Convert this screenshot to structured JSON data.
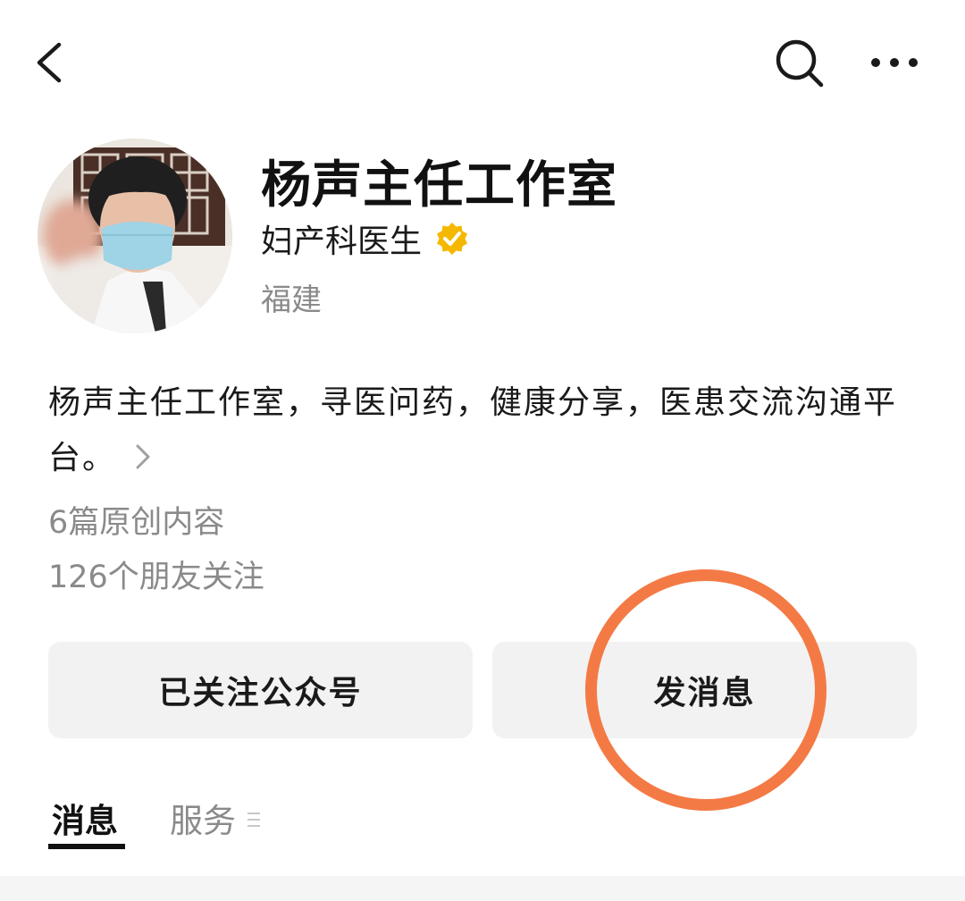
{
  "header": {
    "back_icon": "chevron-left-icon",
    "search_icon": "search-icon",
    "more_icon": "more-horizontal-icon"
  },
  "profile": {
    "name": "杨声主任工作室",
    "role": "妇产科医生",
    "verified_icon": "verified-badge-icon",
    "verified_color": "#f5b800",
    "region": "福建"
  },
  "description": {
    "text": "杨声主任工作室，寻医问药，健康分享，医患交流沟通平台。",
    "arrow_icon": "chevron-right-icon"
  },
  "stats": {
    "original_count": "6篇原创内容",
    "friends_following": "126个朋友关注"
  },
  "actions": {
    "follow_label": "已关注公众号",
    "message_label": "发消息",
    "highlight_color": "#f47a45"
  },
  "tabs": [
    {
      "label": "消息",
      "active": true
    },
    {
      "label": "服务",
      "active": false
    }
  ]
}
